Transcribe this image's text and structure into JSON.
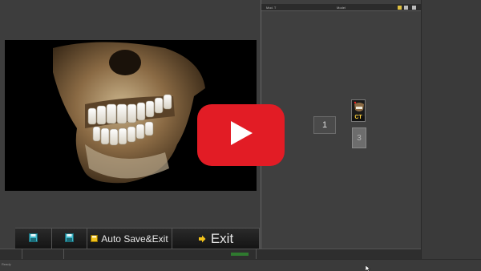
{
  "toolbar": {
    "save_label": "Auto Save&Exit",
    "exit_label": "Exit"
  },
  "right_panel": {
    "header_left": "Mod. T",
    "header_center": "Model",
    "slot_1_label": "1",
    "thumb_label": "CT",
    "slot_3_label": "3"
  },
  "status": {
    "bottom_text": "Ready"
  },
  "colors": {
    "play_red": "#e21c25",
    "ct_label": "#ffd23a",
    "progress_green": "#2f7a2f"
  },
  "icons": {
    "toolbar_1": "save-disk-icon",
    "toolbar_2": "save-disk-icon",
    "save_exit": "disk-icon",
    "exit": "exit-arrow-icon",
    "overlay": "play-icon"
  }
}
